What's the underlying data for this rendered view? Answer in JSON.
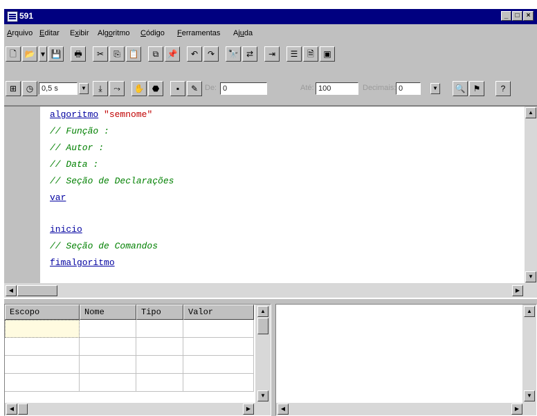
{
  "window": {
    "title": "591"
  },
  "menu": {
    "items": [
      {
        "accel": "A",
        "rest": "rquivo"
      },
      {
        "accel": "E",
        "rest": "ditar"
      },
      {
        "pre": "E",
        "accel": "x",
        "rest": "ibir"
      },
      {
        "pre": "Alg",
        "accel": "o",
        "rest": "ritmo"
      },
      {
        "accel": "C",
        "rest": "ódigo"
      },
      {
        "accel": "F",
        "rest": "erramentas"
      },
      {
        "pre": "Aj",
        "accel": "u",
        "rest": "da"
      }
    ]
  },
  "toolbar2": {
    "interval_value": "0,5 s",
    "de_label": "De:",
    "de_value": "0",
    "ate_label": "Até:",
    "ate_value": "100",
    "decimais_label": "Decimais:",
    "decimais_value": "0"
  },
  "code": {
    "line1_kw": "algoritmo",
    "line1_str": "\"semnome\"",
    "line2": "// Função :",
    "line3": "// Autor :",
    "line4": "// Data :",
    "line5": "// Seção de Declarações",
    "line6": "var",
    "line8": "inicio",
    "line9": "// Seção de Comandos",
    "line10": "fimalgoritmo"
  },
  "grid": {
    "columns": [
      "Escopo",
      "Nome",
      "Tipo",
      "Valor"
    ]
  },
  "icons": {
    "toolbar1": [
      "new-file-icon",
      "open-folder-icon",
      "dropdown-arrow-icon",
      "save-icon",
      "print-icon",
      "cut-icon",
      "copy-icon",
      "paste-icon",
      "copy-to-clipboard-icon",
      "paste-from-clipboard-icon",
      "undo-icon",
      "redo-icon",
      "find-icon",
      "replace-icon",
      "indent-icon",
      "list-icon",
      "page-icon",
      "properties-icon"
    ],
    "toolbar2": [
      "run-icon",
      "timer-icon",
      "step-icon",
      "step-over-icon",
      "breakpoint-hand-icon",
      "stop-icon",
      "dos-icon",
      "magic-wand-icon",
      "search-zoom-icon",
      "flag-icon",
      "help-icon"
    ]
  }
}
